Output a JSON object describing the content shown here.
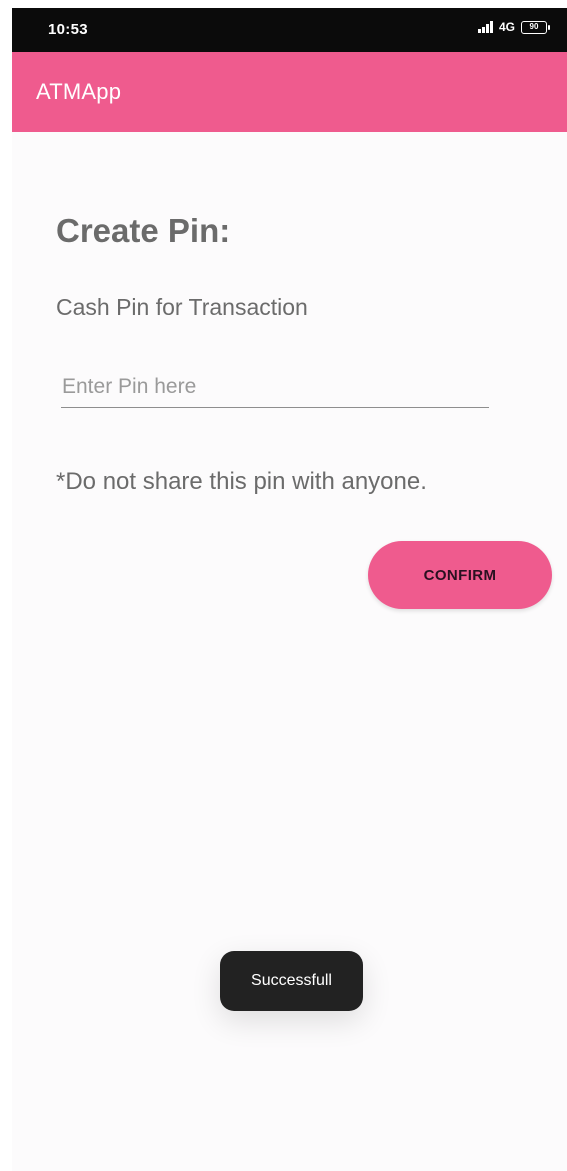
{
  "status_bar": {
    "time": "10:53",
    "network": "4G",
    "battery": "90"
  },
  "app_bar": {
    "title": "ATMApp",
    "color": "#ef5b8e"
  },
  "main": {
    "heading": "Create Pin:",
    "subheading": "Cash Pin for Transaction",
    "pin_input": {
      "placeholder": "Enter Pin here",
      "value": ""
    },
    "warning": "*Do not share this pin with anyone.",
    "confirm_label": "CONFIRM"
  },
  "toast": {
    "message": "Successfull"
  },
  "icons": [
    "signal-icon",
    "battery-icon"
  ]
}
